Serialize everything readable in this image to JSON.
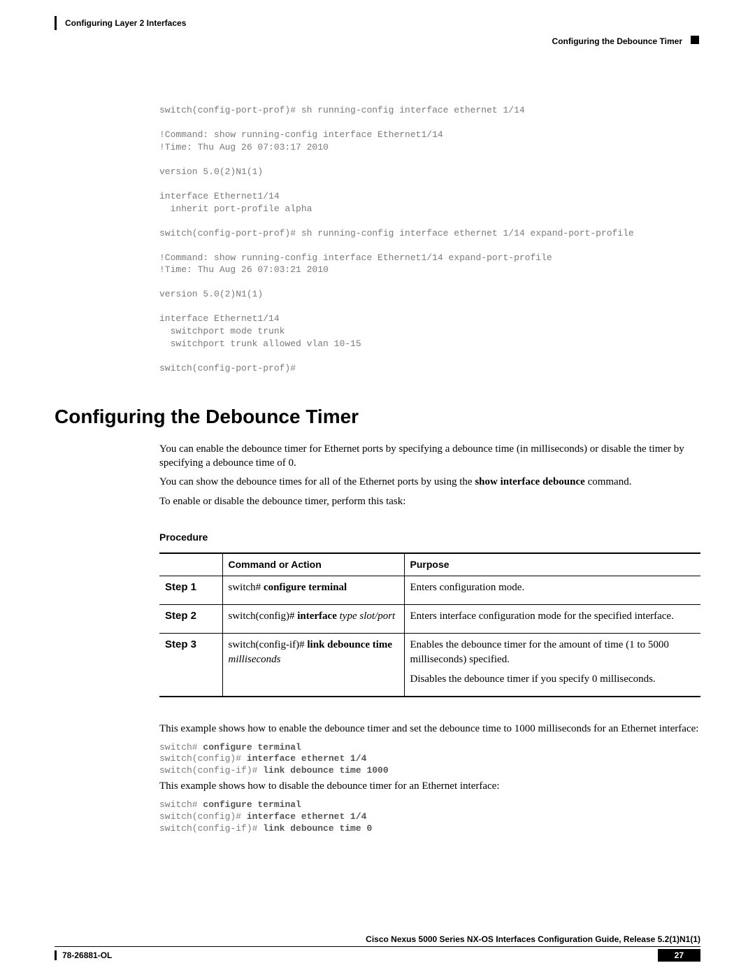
{
  "header": {
    "left": "Configuring Layer 2 Interfaces",
    "right": "Configuring the Debounce Timer"
  },
  "code1": "switch(config-port-prof)# sh running-config interface ethernet 1/14\n\n!Command: show running-config interface Ethernet1/14\n!Time: Thu Aug 26 07:03:17 2010\n\nversion 5.0(2)N1(1)\n\ninterface Ethernet1/14\n  inherit port-profile alpha\n\nswitch(config-port-prof)# sh running-config interface ethernet 1/14 expand-port-profile\n\n!Command: show running-config interface Ethernet1/14 expand-port-profile\n!Time: Thu Aug 26 07:03:21 2010\n\nversion 5.0(2)N1(1)\n\ninterface Ethernet1/14\n  switchport mode trunk\n  switchport trunk allowed vlan 10-15\n\nswitch(config-port-prof)#",
  "section_title": "Configuring the Debounce Timer",
  "para1": "You can enable the debounce timer for Ethernet ports by specifying a debounce time (in milliseconds) or disable the timer by specifying a debounce time of 0.",
  "para2_pre": "You can show the debounce times for all of the Ethernet ports by using the ",
  "para2_bold": "show interface debounce",
  "para2_post": " command.",
  "para3": "To enable or disable the debounce timer, perform this task:",
  "procedure_heading": "Procedure",
  "table": {
    "headers": {
      "step": "",
      "cmd": "Command or Action",
      "purpose": "Purpose"
    },
    "rows": [
      {
        "step": "Step 1",
        "cmd_plain": "switch# ",
        "cmd_bold": "configure terminal",
        "cmd_italic": "",
        "purpose1": "Enters configuration mode.",
        "purpose2": ""
      },
      {
        "step": "Step 2",
        "cmd_plain": "switch(config)# ",
        "cmd_bold": "interface ",
        "cmd_italic": "type slot/port",
        "purpose1": "Enters interface configuration mode for the specified interface.",
        "purpose2": ""
      },
      {
        "step": "Step 3",
        "cmd_plain": "switch(config-if)# ",
        "cmd_bold": "link debounce time ",
        "cmd_italic": "milliseconds",
        "purpose1": "Enables the debounce timer for the amount of time (1 to 5000 milliseconds) specified.",
        "purpose2": "Disables the debounce timer if you specify 0 milliseconds."
      }
    ]
  },
  "after_table_para1": "This example shows how to enable the debounce timer and set the debounce time to 1000 milliseconds for an Ethernet interface:",
  "code2": {
    "l1a": "switch# ",
    "l1b": "configure terminal",
    "l2a": "switch(config)# ",
    "l2b": "interface ethernet 1/4",
    "l3a": "switch(config-if)# ",
    "l3b": "link debounce time 1000"
  },
  "after_table_para2": "This example shows how to disable the debounce timer for an Ethernet interface:",
  "code3": {
    "l1a": "switch# ",
    "l1b": "configure terminal",
    "l2a": "switch(config)# ",
    "l2b": "interface ethernet 1/4",
    "l3a": "switch(config-if)# ",
    "l3b": "link debounce time 0"
  },
  "footer": {
    "guide": "Cisco Nexus 5000 Series NX-OS Interfaces Configuration Guide, Release 5.2(1)N1(1)",
    "ol": "78-26881-OL",
    "page": "27"
  }
}
